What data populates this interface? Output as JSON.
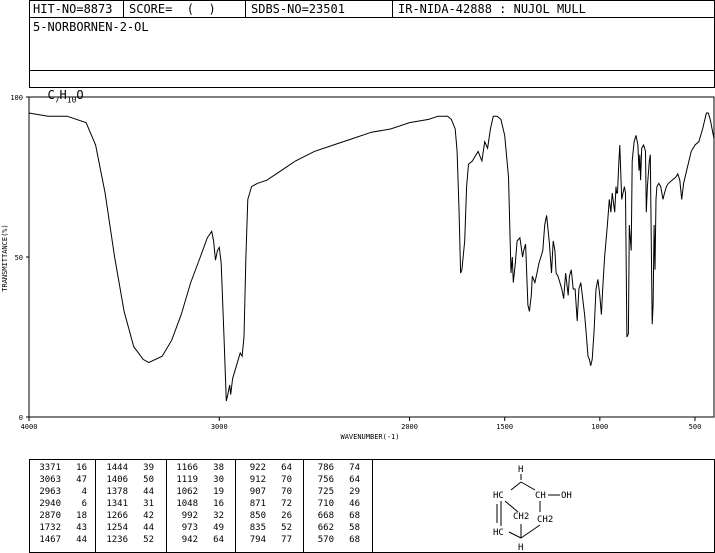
{
  "header": {
    "hit_no": "HIT-NO=8873",
    "score": "SCORE=  (  )",
    "sdbs_no": "SDBS-NO=23501",
    "ir_nida": "IR-NIDA-42888 : NUJOL MULL",
    "compound_name": "5-NORBORNEN-2-OL",
    "formula_prefix": "C",
    "formula_c_sub": "7",
    "formula_h": "H",
    "formula_h_sub": "10",
    "formula_o": "O"
  },
  "chart_data": {
    "type": "line",
    "xlabel": "WAVENUMBER(-1)",
    "ylabel": "TRANSMITTANCE(%)",
    "xlim": [
      4000,
      400
    ],
    "ylim": [
      0,
      100
    ],
    "x_ticks": [
      4000,
      3000,
      2000,
      1500,
      1000,
      500
    ],
    "y_ticks": [
      0,
      50,
      100
    ],
    "series": [
      {
        "points": [
          [
            4000,
            95
          ],
          [
            3900,
            94
          ],
          [
            3800,
            94
          ],
          [
            3700,
            92
          ],
          [
            3650,
            85
          ],
          [
            3600,
            70
          ],
          [
            3550,
            50
          ],
          [
            3500,
            33
          ],
          [
            3450,
            22
          ],
          [
            3400,
            18
          ],
          [
            3371,
            17
          ],
          [
            3300,
            19
          ],
          [
            3250,
            24
          ],
          [
            3200,
            32
          ],
          [
            3150,
            42
          ],
          [
            3100,
            50
          ],
          [
            3063,
            56
          ],
          [
            3040,
            58
          ],
          [
            3030,
            55
          ],
          [
            3020,
            49
          ],
          [
            3010,
            52
          ],
          [
            3000,
            53
          ],
          [
            2990,
            48
          ],
          [
            2975,
            25
          ],
          [
            2963,
            5
          ],
          [
            2955,
            7
          ],
          [
            2945,
            10
          ],
          [
            2940,
            7
          ],
          [
            2930,
            12
          ],
          [
            2910,
            16
          ],
          [
            2890,
            20
          ],
          [
            2880,
            19
          ],
          [
            2870,
            25
          ],
          [
            2860,
            50
          ],
          [
            2850,
            68
          ],
          [
            2830,
            72
          ],
          [
            2800,
            73
          ],
          [
            2750,
            74
          ],
          [
            2700,
            76
          ],
          [
            2650,
            78
          ],
          [
            2600,
            80
          ],
          [
            2500,
            83
          ],
          [
            2400,
            85
          ],
          [
            2300,
            87
          ],
          [
            2200,
            89
          ],
          [
            2100,
            90
          ],
          [
            2000,
            92
          ],
          [
            1900,
            93
          ],
          [
            1850,
            94
          ],
          [
            1800,
            94
          ],
          [
            1780,
            93
          ],
          [
            1760,
            90
          ],
          [
            1750,
            83
          ],
          [
            1740,
            65
          ],
          [
            1732,
            45
          ],
          [
            1725,
            46
          ],
          [
            1710,
            55
          ],
          [
            1700,
            72
          ],
          [
            1690,
            79
          ],
          [
            1670,
            80
          ],
          [
            1650,
            82
          ],
          [
            1640,
            83
          ],
          [
            1620,
            80
          ],
          [
            1605,
            86
          ],
          [
            1590,
            84
          ],
          [
            1575,
            90
          ],
          [
            1560,
            94
          ],
          [
            1540,
            94
          ],
          [
            1520,
            93
          ],
          [
            1500,
            88
          ],
          [
            1480,
            75
          ],
          [
            1467,
            45
          ],
          [
            1460,
            50
          ],
          [
            1455,
            42
          ],
          [
            1444,
            48
          ],
          [
            1435,
            55
          ],
          [
            1420,
            56
          ],
          [
            1406,
            50
          ],
          [
            1400,
            52
          ],
          [
            1390,
            54
          ],
          [
            1378,
            35
          ],
          [
            1370,
            33
          ],
          [
            1360,
            38
          ],
          [
            1355,
            44
          ],
          [
            1341,
            42
          ],
          [
            1330,
            45
          ],
          [
            1320,
            48
          ],
          [
            1300,
            52
          ],
          [
            1290,
            60
          ],
          [
            1280,
            63
          ],
          [
            1266,
            55
          ],
          [
            1254,
            45
          ],
          [
            1245,
            55
          ],
          [
            1236,
            52
          ],
          [
            1230,
            45
          ],
          [
            1220,
            44
          ],
          [
            1200,
            40
          ],
          [
            1190,
            37
          ],
          [
            1180,
            45
          ],
          [
            1166,
            38
          ],
          [
            1160,
            44
          ],
          [
            1150,
            46
          ],
          [
            1140,
            40
          ],
          [
            1130,
            40
          ],
          [
            1119,
            30
          ],
          [
            1110,
            40
          ],
          [
            1100,
            42
          ],
          [
            1090,
            37
          ],
          [
            1080,
            32
          ],
          [
            1070,
            25
          ],
          [
            1062,
            19
          ],
          [
            1055,
            18
          ],
          [
            1048,
            16
          ],
          [
            1040,
            18
          ],
          [
            1030,
            27
          ],
          [
            1020,
            40
          ],
          [
            1010,
            43
          ],
          [
            1000,
            38
          ],
          [
            992,
            32
          ],
          [
            985,
            40
          ],
          [
            975,
            50
          ],
          [
            960,
            60
          ],
          [
            950,
            68
          ],
          [
            942,
            64
          ],
          [
            935,
            70
          ],
          [
            922,
            64
          ],
          [
            915,
            72
          ],
          [
            912,
            70
          ],
          [
            907,
            70
          ],
          [
            900,
            80
          ],
          [
            895,
            85
          ],
          [
            885,
            68
          ],
          [
            871,
            72
          ],
          [
            865,
            70
          ],
          [
            858,
            25
          ],
          [
            850,
            26
          ],
          [
            845,
            60
          ],
          [
            835,
            52
          ],
          [
            830,
            80
          ],
          [
            820,
            86
          ],
          [
            810,
            88
          ],
          [
            800,
            85
          ],
          [
            794,
            77
          ],
          [
            790,
            82
          ],
          [
            786,
            74
          ],
          [
            780,
            84
          ],
          [
            770,
            85
          ],
          [
            760,
            83
          ],
          [
            756,
            64
          ],
          [
            750,
            72
          ],
          [
            740,
            80
          ],
          [
            735,
            82
          ],
          [
            725,
            29
          ],
          [
            720,
            35
          ],
          [
            715,
            60
          ],
          [
            710,
            46
          ],
          [
            705,
            68
          ],
          [
            700,
            72
          ],
          [
            690,
            73
          ],
          [
            680,
            72
          ],
          [
            668,
            68
          ],
          [
            660,
            70
          ],
          [
            650,
            72
          ],
          [
            640,
            73
          ],
          [
            620,
            74
          ],
          [
            600,
            75
          ],
          [
            590,
            76
          ],
          [
            580,
            74
          ],
          [
            570,
            68
          ],
          [
            560,
            73
          ],
          [
            540,
            78
          ],
          [
            520,
            83
          ],
          [
            500,
            85
          ],
          [
            480,
            86
          ],
          [
            470,
            88
          ],
          [
            460,
            90
          ],
          [
            440,
            95
          ],
          [
            430,
            95
          ],
          [
            420,
            93
          ],
          [
            400,
            87
          ]
        ]
      }
    ]
  },
  "peak_table": {
    "columns": [
      {
        "wn": [
          "3371",
          "3063",
          "2963",
          "2940",
          "2870",
          "1732",
          "1467"
        ],
        "t": [
          "16",
          "47",
          "4",
          "6",
          "18",
          "43",
          "44"
        ]
      },
      {
        "wn": [
          "1444",
          "1406",
          "1378",
          "1341",
          "1266",
          "1254",
          "1236"
        ],
        "t": [
          "39",
          "50",
          "44",
          "31",
          "42",
          "44",
          "52"
        ]
      },
      {
        "wn": [
          "1166",
          "1119",
          "1062",
          "1048",
          "992",
          "973",
          "942"
        ],
        "t": [
          "38",
          "30",
          "19",
          "16",
          "32",
          "49",
          "64"
        ]
      },
      {
        "wn": [
          "922",
          "912",
          "907",
          "871",
          "850",
          "835",
          "794"
        ],
        "t": [
          "64",
          "70",
          "70",
          "72",
          "26",
          "52",
          "77"
        ]
      },
      {
        "wn": [
          "786",
          "756",
          "725",
          "710",
          "668",
          "662",
          "570"
        ],
        "t": [
          "74",
          "64",
          "29",
          "46",
          "68",
          "58",
          "68"
        ]
      }
    ]
  },
  "structure": {
    "h_top": "H",
    "hc": "HC",
    "ch": "CH",
    "oh": "OH",
    "ch2_bridge": "CH2",
    "ch2": "CH2",
    "hc_low": "HC",
    "h_bottom": "H"
  }
}
